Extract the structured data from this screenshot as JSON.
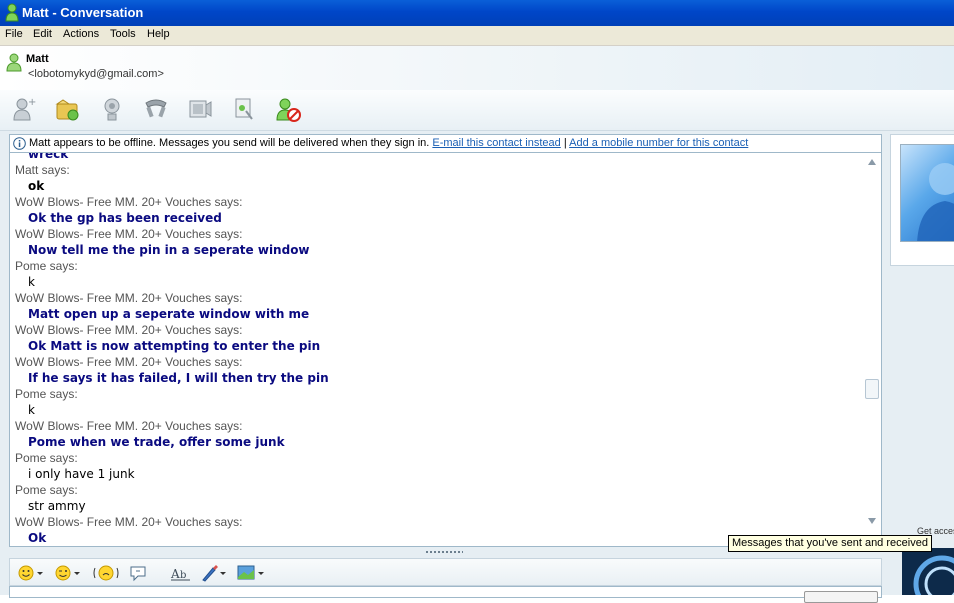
{
  "window": {
    "title": "Matt - Conversation"
  },
  "menu": [
    "File",
    "Edit",
    "Actions",
    "Tools",
    "Help"
  ],
  "contact": {
    "name": "Matt",
    "email": "<lobotomykyd@gmail.com>"
  },
  "info_bar": {
    "text": "Matt appears to be offline. Messages you send will be delivered when they sign in.",
    "link_email": "E-mail this contact instead",
    "separator": "|",
    "link_mobile": "Add a mobile number for this contact"
  },
  "messages": [
    {
      "sender": "",
      "text": "wreck",
      "bold": true,
      "color": "#0a0a80"
    },
    {
      "sender": "Matt says:",
      "text": "ok",
      "bold": true,
      "color": "#000000"
    },
    {
      "sender": "WoW Blows- Free MM. 20+ Vouches says:",
      "text": "Ok the gp has been received",
      "bold": true,
      "color": "#0a0a80"
    },
    {
      "sender": "WoW Blows- Free MM. 20+ Vouches says:",
      "text": "Now tell me the pin in a seperate window",
      "bold": true,
      "color": "#0a0a80"
    },
    {
      "sender": "Pome says:",
      "text": "k",
      "bold": false,
      "color": "#000000"
    },
    {
      "sender": "WoW Blows- Free MM. 20+ Vouches says:",
      "text": "Matt open up a seperate window with me",
      "bold": true,
      "color": "#0a0a80"
    },
    {
      "sender": "WoW Blows- Free MM. 20+ Vouches says:",
      "text": "Ok Matt is now attempting to enter the pin",
      "bold": true,
      "color": "#0a0a80"
    },
    {
      "sender": "WoW Blows- Free MM. 20+ Vouches says:",
      "text": "If he says it has failed, I will then try the pin",
      "bold": true,
      "color": "#0a0a80"
    },
    {
      "sender": "Pome says:",
      "text": "k",
      "bold": false,
      "color": "#000000"
    },
    {
      "sender": "WoW Blows- Free MM. 20+ Vouches says:",
      "text": "Pome when we trade, offer some junk",
      "bold": true,
      "color": "#0a0a80"
    },
    {
      "sender": "Pome says:",
      "text": "i only have 1 junk",
      "bold": false,
      "color": "#000000"
    },
    {
      "sender": "Pome says:",
      "text": "str ammy",
      "bold": false,
      "color": "#000000"
    },
    {
      "sender": "WoW Blows- Free MM. 20+ Vouches says:",
      "text": "Ok",
      "bold": true,
      "color": "#0a0a80"
    }
  ],
  "side": {
    "get_access": "Get acces"
  },
  "tooltip": "Messages that you've sent and received",
  "toolbar_icons": [
    "invite-contact-icon",
    "send-files-icon",
    "webcam-icon",
    "call-icon",
    "video-icon",
    "activities-icon",
    "block-icon"
  ],
  "compose_icons": [
    "emoticon-icon",
    "wink-icon",
    "nudge-icon",
    "voice-clip-icon",
    "font-icon",
    "background-icon",
    "backgrounds-picture-icon"
  ],
  "colors": {
    "title_bar": "#0046c8",
    "link": "#1a5fb4",
    "message_bold": "#0a0a80",
    "sender": "#555555"
  }
}
